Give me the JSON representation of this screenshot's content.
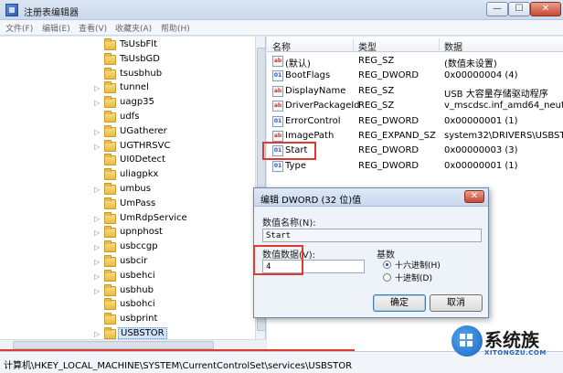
{
  "window": {
    "title": "注册表编辑器",
    "min": "—",
    "max": "☐",
    "close": "✕"
  },
  "menu": [
    "文件(F)",
    "编辑(E)",
    "查看(V)",
    "收藏夹(A)",
    "帮助(H)"
  ],
  "tree": {
    "items": [
      {
        "label": "TsUsbFlt",
        "expander": ""
      },
      {
        "label": "TsUsbGD",
        "expander": ""
      },
      {
        "label": "tsusbhub",
        "expander": ""
      },
      {
        "label": "tunnel",
        "expander": "▷"
      },
      {
        "label": "uagp35",
        "expander": "▷"
      },
      {
        "label": "udfs",
        "expander": ""
      },
      {
        "label": "UGatherer",
        "expander": "▷"
      },
      {
        "label": "UGTHRSVC",
        "expander": "▷"
      },
      {
        "label": "UI0Detect",
        "expander": ""
      },
      {
        "label": "uliagpkx",
        "expander": ""
      },
      {
        "label": "umbus",
        "expander": "▷"
      },
      {
        "label": "UmPass",
        "expander": ""
      },
      {
        "label": "UmRdpService",
        "expander": "▷"
      },
      {
        "label": "upnphost",
        "expander": "▷"
      },
      {
        "label": "usbccgp",
        "expander": "▷"
      },
      {
        "label": "usbcir",
        "expander": "▷"
      },
      {
        "label": "usbehci",
        "expander": "▷"
      },
      {
        "label": "usbhub",
        "expander": "▷"
      },
      {
        "label": "usbohci",
        "expander": ""
      },
      {
        "label": "usbprint",
        "expander": ""
      },
      {
        "label": "USBSTOR",
        "expander": "▷",
        "selected": true
      }
    ]
  },
  "list": {
    "headers": {
      "name": "名称",
      "type": "类型",
      "data": "数据"
    },
    "rows": [
      {
        "name": "(默认)",
        "type": "REG_SZ",
        "data": "(数值未设置)",
        "kind": "sz"
      },
      {
        "name": "BootFlags",
        "type": "REG_DWORD",
        "data": "0x00000004 (4)",
        "kind": "dw"
      },
      {
        "name": "DisplayName",
        "type": "REG_SZ",
        "data": "USB 大容量存储驱动程序",
        "kind": "sz"
      },
      {
        "name": "DriverPackageId",
        "type": "REG_SZ",
        "data": "v_mscdsc.inf_amd64_neutra",
        "kind": "sz"
      },
      {
        "name": "ErrorControl",
        "type": "REG_DWORD",
        "data": "0x00000001 (1)",
        "kind": "dw"
      },
      {
        "name": "ImagePath",
        "type": "REG_EXPAND_SZ",
        "data": "system32\\DRIVERS\\USBSTO",
        "kind": "sz"
      },
      {
        "name": "Start",
        "type": "REG_DWORD",
        "data": "0x00000003 (3)",
        "kind": "dw"
      },
      {
        "name": "Type",
        "type": "REG_DWORD",
        "data": "0x00000001 (1)",
        "kind": "dw"
      }
    ]
  },
  "dialog": {
    "title": "编辑 DWORD (32 位)值",
    "close": "✕",
    "value_name_label": "数值名称(N):",
    "value_name": "Start",
    "value_data_label": "数值数据(V):",
    "value_data": "4",
    "base_label": "基数",
    "radio_hex": "十六进制(H)",
    "radio_dec": "十进制(D)",
    "ok": "确定",
    "cancel": "取消"
  },
  "status": {
    "path": "计算机\\HKEY_LOCAL_MACHINE\\SYSTEM\\CurrentControlSet\\services\\USBSTOR"
  },
  "watermark": {
    "text": "系统族",
    "sub": "XITONGZU.COM"
  },
  "colors": {
    "highlight": "#e0392f",
    "selection": "#cfe3fb"
  }
}
